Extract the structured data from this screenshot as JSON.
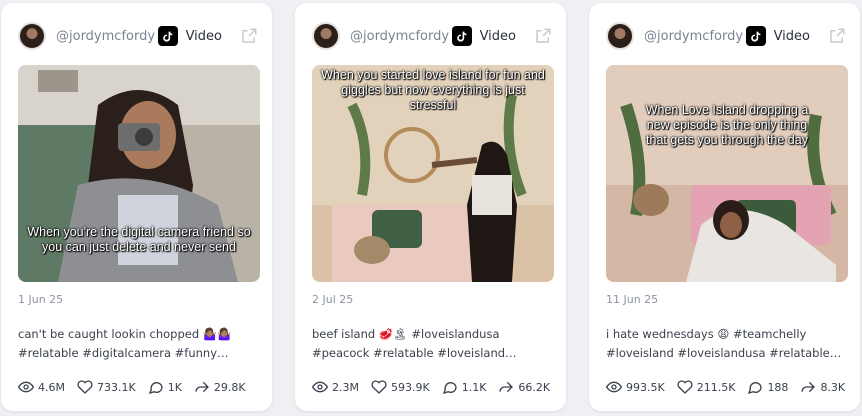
{
  "cards": [
    {
      "username": "@jordymcfordy",
      "platform": "Video",
      "overlay": "When you're the digital camera friend so you can just delete and never send",
      "date": "1 Jun 25",
      "desc_line1": "can't be caught lookin chopped 🤷🏽‍♀️🤷🏽‍♀️",
      "desc_line2": "#relatable #digitalcamera #funny…",
      "views": "4.6M",
      "likes": "733.1K",
      "comments": "1K",
      "shares": "29.8K"
    },
    {
      "username": "@jordymcfordy",
      "platform": "Video",
      "overlay": "When you started love island for fun and giggles but now everything is just stressful",
      "date": "2 Jul 25",
      "desc_line1": "beef island 🥩🏝 #loveislandusa",
      "desc_line2": "#peacock #relatable #loveisland…",
      "views": "2.3M",
      "likes": "593.9K",
      "comments": "1.1K",
      "shares": "66.2K"
    },
    {
      "username": "@jordymcfordy",
      "platform": "Video",
      "overlay": "When Love Island dropping a new episode is the only thing that gets you through the day",
      "date": "11 Jun 25",
      "desc_line1": "i hate wednesdays 😩 #teamchelly",
      "desc_line2": "#loveisland #loveislandusa #relatable…",
      "views": "993.5K",
      "likes": "211.5K",
      "comments": "188",
      "shares": "8.3K"
    }
  ],
  "colors": {
    "text_muted": "#8d95a3",
    "text_main": "#3a414d",
    "card_bg": "#ffffff",
    "page_bg": "#eef0f4"
  },
  "icons": [
    "tiktok-icon",
    "external-link-icon",
    "eye-icon",
    "heart-icon",
    "comment-icon",
    "share-icon"
  ]
}
